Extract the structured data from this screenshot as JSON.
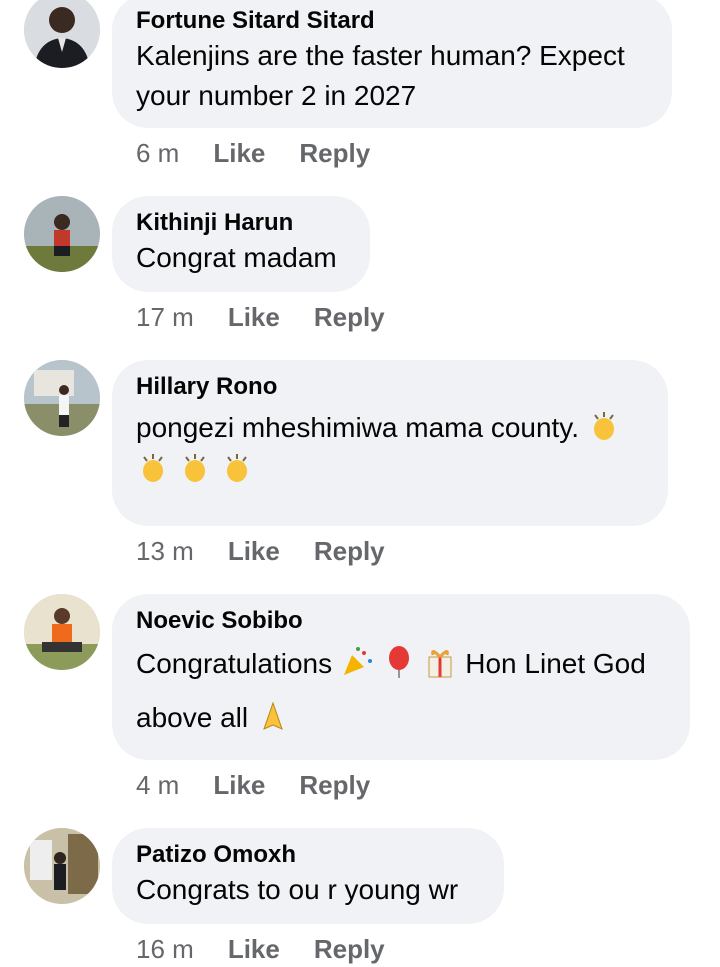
{
  "comments": [
    {
      "author": "Fortune Sitard Sitard",
      "text_lines": [
        "Kalenjins are the faster human? Expect",
        "your number 2 in 2027"
      ],
      "time": "6 m",
      "like": "Like",
      "reply": "Reply",
      "avatar_icon": "profile-photo-man-suit"
    },
    {
      "author": "Kithinji Harun",
      "text_lines": [
        "Congrat madam"
      ],
      "time": "17 m",
      "like": "Like",
      "reply": "Reply",
      "avatar_icon": "profile-photo-man-outdoors"
    },
    {
      "author": "Hillary Rono",
      "text_lines": [
        "pongezi mheshimiwa mama county.",
        ""
      ],
      "time": "13 m",
      "like": "Like",
      "reply": "Reply",
      "avatar_icon": "profile-photo-man-yard",
      "emojis": [
        "clapping-hands",
        "clapping-hands",
        "clapping-hands",
        "clapping-hands"
      ]
    },
    {
      "author": "Noevic Sobibo",
      "text_lines": [
        "Congratulations",
        "Hon Linet God",
        "above all"
      ],
      "time": "4 m",
      "like": "Like",
      "reply": "Reply",
      "avatar_icon": "profile-photo-man-orange-shirt",
      "emojis": [
        "party-popper",
        "balloon",
        "wrapped-gift",
        "folded-hands"
      ]
    },
    {
      "author": "Patizo Omoxh",
      "text_lines": [
        "Congrats to ou r young wr"
      ],
      "time": "16 m",
      "like": "Like",
      "reply": "Reply",
      "avatar_icon": "profile-photo-man-building"
    }
  ],
  "colors": {
    "bubble": "#f0f2f5",
    "meta": "#65676b",
    "text": "#050505"
  }
}
